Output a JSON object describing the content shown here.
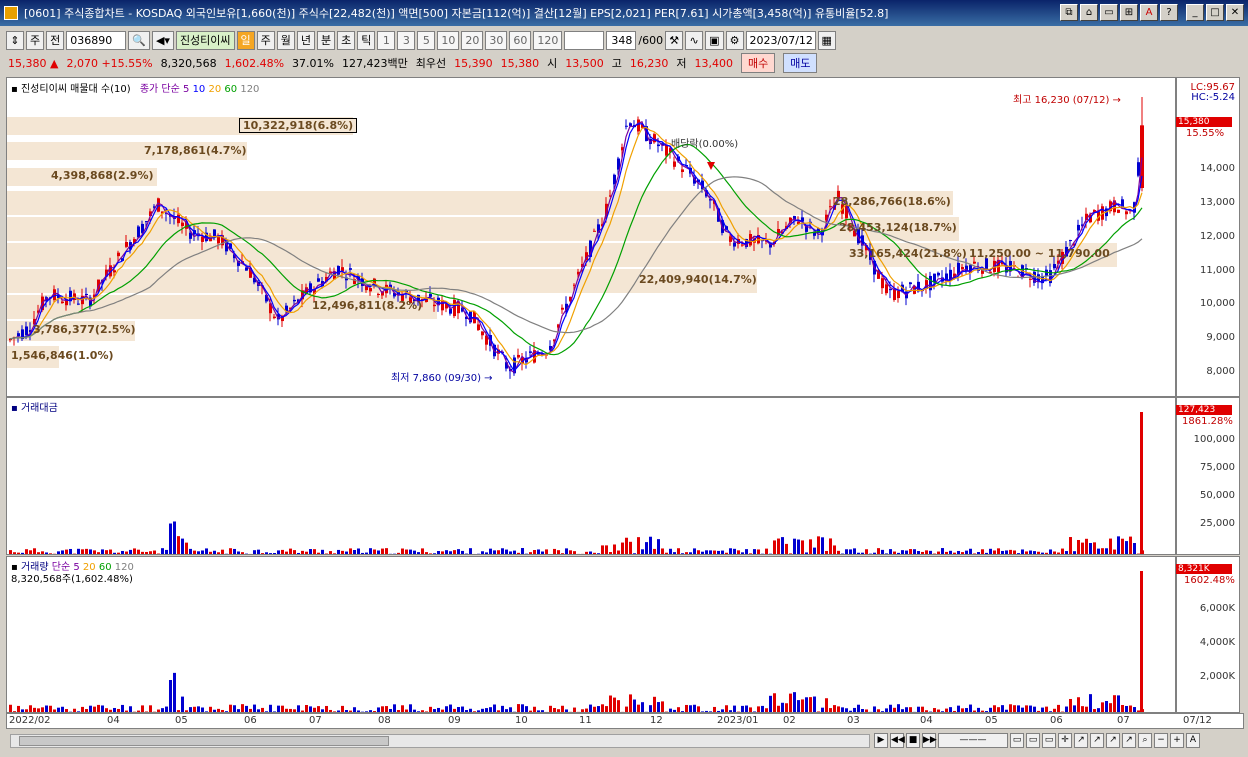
{
  "window": {
    "title": "[0601] 주식종합차트 - KOSDAQ 외국인보유[1,660(천)] 주식수[22,482(천)] 액면[500] 자본금[112(억)] 결산[12월] EPS[2,021] PER[7.61] 시가총액[3,458(억)] 유통비율[52.8]"
  },
  "toolbar": {
    "stock_type": "주",
    "prev_label": "전",
    "code": "036890",
    "stock_name": "진성티이씨",
    "periods": [
      "일",
      "주",
      "월",
      "년",
      "분",
      "초",
      "틱"
    ],
    "intervals": [
      "1",
      "3",
      "5",
      "10",
      "20",
      "30",
      "60",
      "120"
    ],
    "count_value": "348",
    "count_total": "/600",
    "date": "2023/07/12"
  },
  "quote": {
    "price": "15,380 ▲",
    "change": "2,070 +15.55%",
    "volume": "8,320,568",
    "volume_ratio": "1,602.48%",
    "turnover": "37.01%",
    "amount": "127,423백만",
    "pref_label": "최우선",
    "ask": "15,390",
    "bid": "15,380",
    "open_label": "시",
    "open": "13,500",
    "high_label": "고",
    "high": "16,230",
    "low_label": "저",
    "low": "13,400",
    "buy_label": "매수",
    "sell_label": "매도"
  },
  "price_panel": {
    "legend_name": "진성티이씨 매물대 수(10)",
    "legend_ma": "종가 단순 5",
    "ma_periods": [
      "10",
      "20",
      "60",
      "120"
    ],
    "lc": "LC:95.67",
    "hc": "HC:-5.24",
    "current_price_tag": "15,380",
    "current_pct_tag": "15.55%",
    "y_ticks": [
      "14,000",
      "13,000",
      "12,000",
      "11,000",
      "10,000",
      "9,000",
      "8,000"
    ],
    "max_annotation": "최고 16,230 (07/12) →",
    "min_annotation": "최저 7,860 (09/30) →",
    "dividend_annotation": "배당락(0.00%)",
    "volume_profile": [
      "10,322,918(6.8%)",
      "7,178,861(4.7%)",
      "4,398,868(2.9%)",
      "28,286,766(18.6%)",
      "28,453,124(18.7%)",
      "33,165,424(21.8%)",
      "22,409,940(14.7%)",
      "12,496,811(8.2%)",
      "3,786,377(2.5%)",
      "1,546,846(1.0%)"
    ],
    "range_annotation": "11,250.00 ~ 11,790.00"
  },
  "amount_panel": {
    "legend": "거래대금",
    "value_tag": "127,423",
    "pct_tag": "1861.28%",
    "y_ticks": [
      "100,000",
      "75,000",
      "50,000",
      "25,000"
    ]
  },
  "volume_panel": {
    "legend_name": "거래량",
    "legend_ma": "단순 5",
    "ma_periods": [
      "20",
      "60",
      "120"
    ],
    "sub_legend": "8,320,568주(1,602.48%)",
    "value_tag": "8,321K",
    "pct_tag": "1602.48%",
    "y_ticks": [
      "6,000K",
      "4,000K",
      "2,000K"
    ]
  },
  "x_axis": {
    "labels": [
      "2022/02",
      "04",
      "05",
      "06",
      "07",
      "08",
      "09",
      "10",
      "11",
      "12",
      "2023/01",
      "02",
      "03",
      "04",
      "05",
      "06",
      "07"
    ],
    "last_date": "07/12"
  },
  "colors": {
    "up": "#e00000",
    "down": "#0000d0",
    "ma5": "#7a00a0",
    "ma10": "#0000ff",
    "ma20": "#f0a000",
    "ma60": "#00a000",
    "ma120": "#808080",
    "profile": "#f4e6d4"
  },
  "chart_data": {
    "type": "candlestick",
    "price_range": [
      7500,
      16500
    ],
    "high": 16230,
    "low": 7860,
    "last_close": 15380,
    "volume_last": 8320568,
    "amount_last_million": 127423
  }
}
